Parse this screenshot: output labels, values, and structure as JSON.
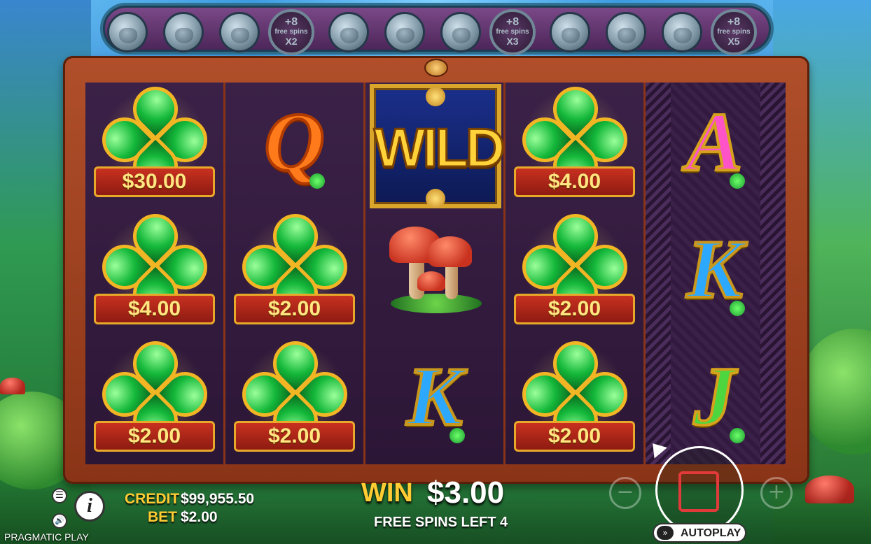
{
  "brand": "PRAGMATIC PLAY",
  "progress": {
    "items": [
      {
        "type": "pot"
      },
      {
        "type": "pot"
      },
      {
        "type": "pot"
      },
      {
        "type": "badge",
        "plus": "+8",
        "text": "free spins",
        "mult": "X2"
      },
      {
        "type": "pot"
      },
      {
        "type": "pot"
      },
      {
        "type": "pot"
      },
      {
        "type": "badge",
        "plus": "+8",
        "text": "free spins",
        "mult": "X3"
      },
      {
        "type": "pot"
      },
      {
        "type": "pot"
      },
      {
        "type": "pot"
      },
      {
        "type": "badge",
        "plus": "+8",
        "text": "free spins",
        "mult": "X5"
      }
    ]
  },
  "reels": [
    [
      {
        "symbol": "clover",
        "value": "$30.00"
      },
      {
        "symbol": "clover",
        "value": "$4.00"
      },
      {
        "symbol": "clover",
        "value": "$2.00"
      }
    ],
    [
      {
        "symbol": "Q"
      },
      {
        "symbol": "clover",
        "value": "$2.00"
      },
      {
        "symbol": "clover",
        "value": "$2.00"
      }
    ],
    [
      {
        "symbol": "wild",
        "text": "WILD"
      },
      {
        "symbol": "mushroom"
      },
      {
        "symbol": "K"
      }
    ],
    [
      {
        "symbol": "clover",
        "value": "$4.00"
      },
      {
        "symbol": "clover",
        "value": "$2.00"
      },
      {
        "symbol": "clover",
        "value": "$2.00"
      }
    ],
    [
      {
        "symbol": "A"
      },
      {
        "symbol": "K"
      },
      {
        "symbol": "J"
      }
    ]
  ],
  "status": {
    "credit_label": "CREDIT",
    "credit_value": "$99,955.50",
    "bet_label": "BET",
    "bet_value": "$2.00",
    "win_label": "WIN",
    "win_value": "$3.00",
    "free_spins_left": "FREE SPINS LEFT 4"
  },
  "controls": {
    "menu_icon": "menu-icon",
    "info_icon": "info-icon",
    "sound_icon": "sound-icon",
    "minus_label": "−",
    "plus_label": "+",
    "autoplay_label": "AUTOPLAY"
  }
}
